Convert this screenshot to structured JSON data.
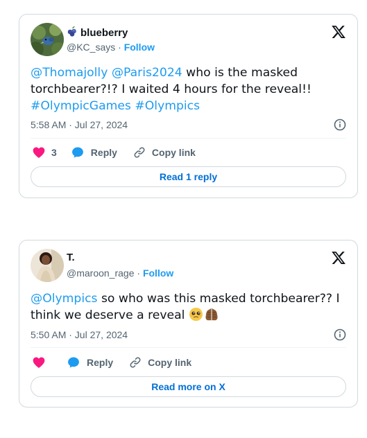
{
  "colors": {
    "link": "#1d9bf0",
    "secondary_text": "#536471",
    "border": "#cfd9de",
    "heart": "#f91880",
    "read_button_text": "#006fd6"
  },
  "tweets": [
    {
      "display_name": "blueberry",
      "name_emoji_icon": "blueberries-icon",
      "handle": "@KC_says",
      "separator": "·",
      "follow_label": "Follow",
      "text_parts": {
        "mention1": "@Thomajolly",
        "mention2": "@Paris2024",
        "body": " who is the masked torchbearer?!? I waited 4 hours for the reveal!!",
        "hashtag1": "#OlympicGames",
        "hashtag2": "#Olympics"
      },
      "timestamp": "5:58 AM · Jul 27, 2024",
      "like_count": "3",
      "reply_label": "Reply",
      "copy_link_label": "Copy link",
      "read_button_label": "Read 1 reply"
    },
    {
      "display_name": "T.",
      "handle": "@maroon_rage",
      "separator": "·",
      "follow_label": "Follow",
      "text_parts": {
        "mention1": "@Olympics",
        "body": " so who was this masked torchbearer?? I think we deserve a reveal ",
        "emoji1": "pleading-face-icon",
        "emoji2": "folded-hands-icon"
      },
      "timestamp": "5:50 AM · Jul 27, 2024",
      "reply_label": "Reply",
      "copy_link_label": "Copy link",
      "read_button_label": "Read more on X"
    }
  ]
}
